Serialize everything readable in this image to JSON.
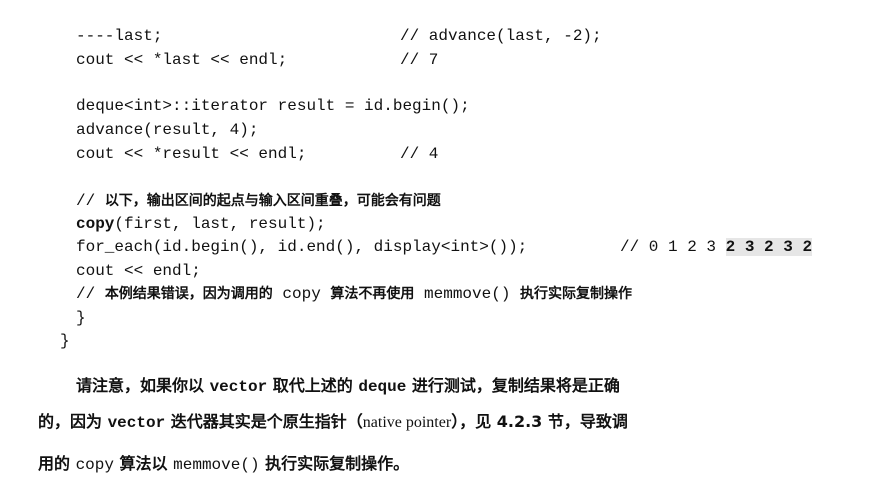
{
  "code": {
    "l1": "----last;",
    "l1c": "// advance(last, -2);",
    "l2": "cout << *last << endl;",
    "l2c": "// 7",
    "l3": "deque<int>::iterator result = id.begin();",
    "l4": "advance(result, 4);",
    "l5": "cout << *result << endl;",
    "l5c": "// 4",
    "c6_prefix": "// ",
    "c6_text": "以下，输出区间的起点与输入区间重叠，可能会有问题",
    "l7_kw": "copy",
    "l7_rest": "(first, last, result);",
    "l8": "for_each(id.begin(), id.end(), display<int>());",
    "l8c_prefix": "// 0 1 2 3 ",
    "l8c_hl": "2 3 2 3 2",
    "l9": "cout << endl;",
    "c10_prefix": "// ",
    "c10_a": "本例结果错误，因为调用的",
    "c10_b": " copy ",
    "c10_c": "算法不再使用",
    "c10_d": " memmove() ",
    "c10_e": "执行实际复制操作",
    "brace_inner": "}",
    "brace_outer": "}"
  },
  "prose": {
    "p1_a": "请注意，如果你以 ",
    "p1_b": "vector",
    "p1_c": " 取代上述的 ",
    "p1_d": "deque",
    "p1_e": " 进行测试，复制结果将是正确",
    "p2_a": "的，因为 ",
    "p2_b": "vector",
    "p2_c": " 迭代器其实是个原生指针（",
    "p2_d": "native pointer",
    "p2_e": "），见 4.2.3 节，导致调",
    "p3_a": "用的 ",
    "p3_b": "copy",
    "p3_c": " 算法以 ",
    "p3_d": "memmove()",
    "p3_e": " 执行实际复制操作。"
  }
}
